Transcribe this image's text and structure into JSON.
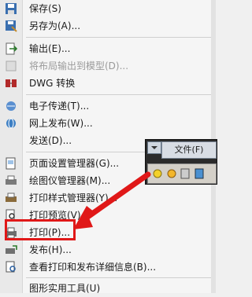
{
  "menu": {
    "items": [
      {
        "label": "保存(S)",
        "icon": "save-icon"
      },
      {
        "label": "另存为(A)...",
        "icon": "save-as-icon"
      },
      {
        "label": "输出(E)...",
        "icon": "export-icon"
      },
      {
        "label": "将布局输出到模型(D)...",
        "icon": "export-layout-icon",
        "disabled": true
      },
      {
        "label": "DWG 转换",
        "icon": "dwg-convert-icon"
      },
      {
        "label": "电子传递(T)...",
        "icon": "etransmit-icon"
      },
      {
        "label": "网上发布(W)...",
        "icon": "publish-web-icon"
      },
      {
        "label": "发送(D)...",
        "icon": "send-icon"
      },
      {
        "label": "页面设置管理器(G)...",
        "icon": "page-setup-icon"
      },
      {
        "label": "绘图仪管理器(M)...",
        "icon": "plotter-manager-icon"
      },
      {
        "label": "打印样式管理器(Y)...",
        "icon": "plot-style-icon"
      },
      {
        "label": "打印预览(V)",
        "icon": "print-preview-icon"
      },
      {
        "label": "打印(P)...",
        "icon": "print-icon"
      },
      {
        "label": "发布(H)...",
        "icon": "publish-icon"
      },
      {
        "label": "查看打印和发布详细信息(B)...",
        "icon": "plot-details-icon"
      },
      {
        "label": "图形实用工具(U)",
        "icon": "drawing-utilities-icon"
      }
    ]
  },
  "inset": {
    "file_tab": "文件(F)"
  },
  "colors": {
    "highlight": "#e01818",
    "menu_bg": "#f5f5f5"
  }
}
